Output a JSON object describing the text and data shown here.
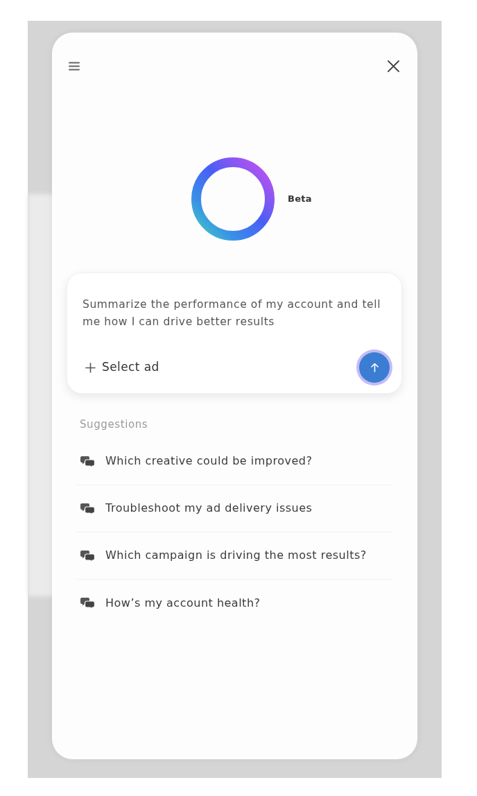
{
  "logo": {
    "badge": "Beta"
  },
  "composer": {
    "prompt": "Summarize the performance of my account and tell me how I can drive better results",
    "attach_button": "Select ad"
  },
  "suggestions": {
    "heading": "Suggestions",
    "items": [
      {
        "label": "Which creative could be improved?"
      },
      {
        "label": "Troubleshoot my ad delivery issues"
      },
      {
        "label": "Which campaign is driving the most results?"
      },
      {
        "label": "How’s my account health?"
      }
    ]
  }
}
